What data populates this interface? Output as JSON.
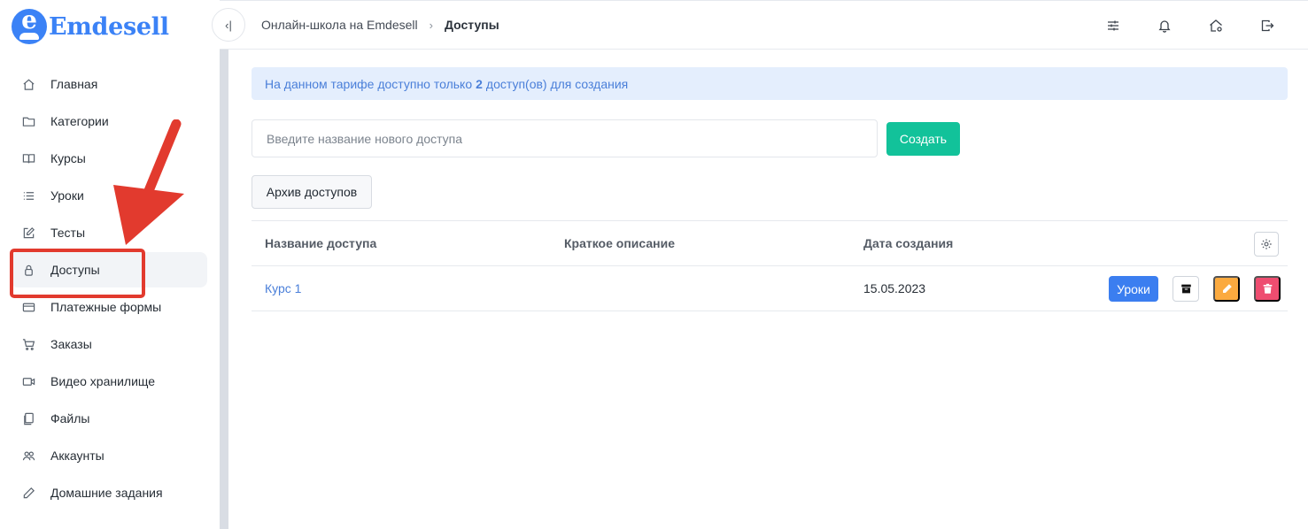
{
  "brand": {
    "name": "Emdesell",
    "logo_letter": "e",
    "color": "#3b82f6"
  },
  "sidebar": {
    "items": [
      {
        "id": "home",
        "label": "Главная",
        "icon": "home-icon"
      },
      {
        "id": "categories",
        "label": "Категории",
        "icon": "folder-icon"
      },
      {
        "id": "courses",
        "label": "Курсы",
        "icon": "book-icon"
      },
      {
        "id": "lessons",
        "label": "Уроки",
        "icon": "list-icon"
      },
      {
        "id": "tests",
        "label": "Тесты",
        "icon": "edit-icon"
      },
      {
        "id": "access",
        "label": "Доступы",
        "icon": "lock-icon",
        "active": true
      },
      {
        "id": "payment-forms",
        "label": "Платежные формы",
        "icon": "credit-card-icon"
      },
      {
        "id": "orders",
        "label": "Заказы",
        "icon": "cart-icon"
      },
      {
        "id": "video-storage",
        "label": "Видео хранилище",
        "icon": "video-icon"
      },
      {
        "id": "files",
        "label": "Файлы",
        "icon": "file-icon"
      },
      {
        "id": "accounts",
        "label": "Аккаунты",
        "icon": "users-icon"
      },
      {
        "id": "homework",
        "label": "Домашние задания",
        "icon": "pencil-icon"
      }
    ]
  },
  "header": {
    "collapse_label": "‹|",
    "breadcrumb": {
      "parent": "Онлайн-школа на Emdesell",
      "separator": "›",
      "current": "Доступы"
    },
    "icons": [
      "sliders-icon",
      "bell-icon",
      "home-settings-icon",
      "logout-icon"
    ]
  },
  "main": {
    "alert": {
      "text_before": "На данном тарифе доступно только",
      "count": "2",
      "text_after": "доступ(ов) для создания"
    },
    "create": {
      "placeholder": "Введите название нового доступа",
      "value": "",
      "button_label": "Создать"
    },
    "archive_button_label": "Архив доступов",
    "table": {
      "columns": [
        "Название доступа",
        "Краткое описание",
        "Дата создания"
      ],
      "rows": [
        {
          "name": "Курс 1",
          "description": "",
          "date": "15.05.2023",
          "lessons_label": "Уроки"
        }
      ]
    }
  },
  "colors": {
    "accent": "#3b82f6",
    "create_button": "#12c29a",
    "lessons_button": "#3b7ef0",
    "edit_button": "#fbaa3f",
    "delete_button": "#ee4d70",
    "alert_bg": "#e4eefd",
    "annotation": "#e23a2e"
  }
}
